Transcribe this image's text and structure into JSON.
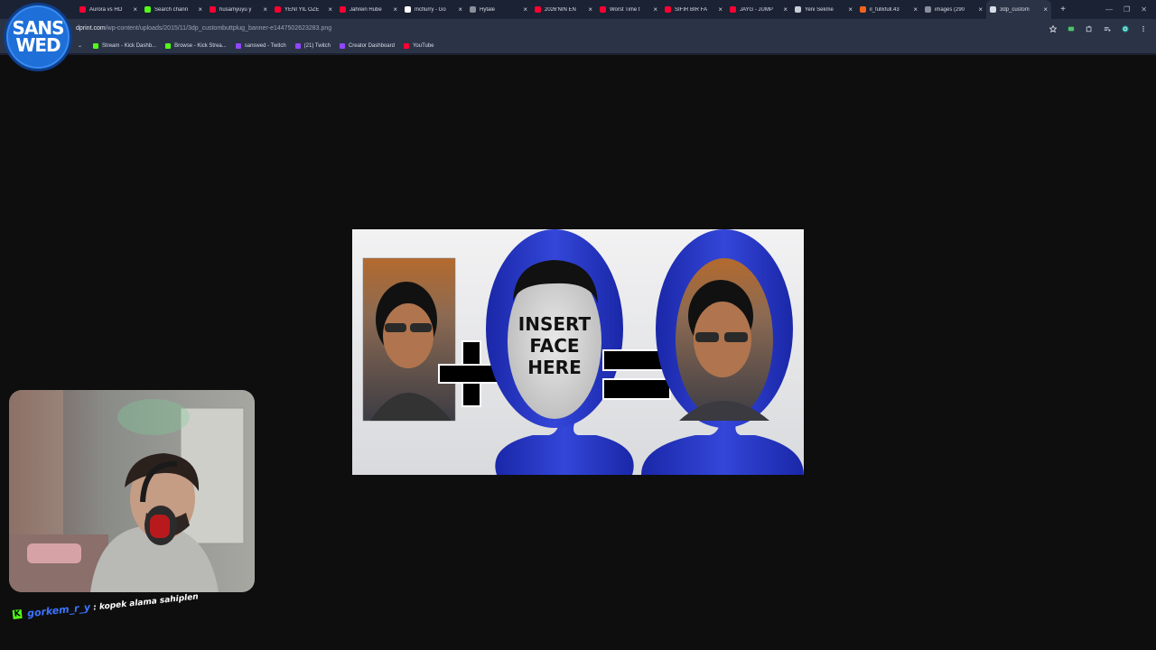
{
  "logo": {
    "line1": "SANS",
    "line2": "WED"
  },
  "tabs": [
    {
      "title": "Aurora vs HO",
      "icon": "youtube-icon",
      "color": "#ff0033"
    },
    {
      "title": "Search chann",
      "icon": "kick-icon",
      "color": "#53fc18"
    },
    {
      "title": "husamyuyu y",
      "icon": "youtube-icon",
      "color": "#ff0033"
    },
    {
      "title": "YENİ YIL ÖZE",
      "icon": "youtube-icon",
      "color": "#ff0033"
    },
    {
      "title": "Jahrein Hube",
      "icon": "youtube-icon",
      "color": "#ff0033"
    },
    {
      "title": "mcflurry - Go",
      "icon": "google-icon",
      "color": "#ffffff"
    },
    {
      "title": "Hytale",
      "icon": "page-icon",
      "color": "#8a8f9c"
    },
    {
      "title": "2026'NIN EN",
      "icon": "youtube-icon",
      "color": "#ff0033"
    },
    {
      "title": "Worst Time t",
      "icon": "youtube-icon",
      "color": "#ff0033"
    },
    {
      "title": "SIFIR BİR FA",
      "icon": "youtube-icon",
      "color": "#ff0033"
    },
    {
      "title": "JAYG - JUMP",
      "icon": "youtube-icon",
      "color": "#ff0033"
    },
    {
      "title": "Yeni Sekme",
      "icon": "chrome-icon",
      "color": "#c9cdd6"
    },
    {
      "title": "il_fullxfull.43",
      "icon": "etsy-icon",
      "color": "#f1641e"
    },
    {
      "title": "images (290",
      "icon": "image-icon",
      "color": "#8a8f9c"
    },
    {
      "title": "3dp_custom",
      "icon": "page-icon",
      "color": "#d8dde8",
      "active": true
    }
  ],
  "tab_close_glyph": "×",
  "new_tab_glyph": "+",
  "window_controls": {
    "minimize": "—",
    "maximize": "❐",
    "close": "✕"
  },
  "address_bar": {
    "host": "dprint.com",
    "path": "/wp-content/uploads/2015/11/3dp_custombuttplug_banner-e1447502623283.png"
  },
  "bookmarks": [
    {
      "label": "Stream - Kick Dashb...",
      "color": "#53fc18"
    },
    {
      "label": "Browse - Kick Strea...",
      "color": "#53fc18"
    },
    {
      "label": "sanswed - Twitch",
      "color": "#9146ff"
    },
    {
      "label": "(21) Twitch",
      "color": "#9146ff"
    },
    {
      "label": "Creator Dashboard",
      "color": "#9146ff"
    },
    {
      "label": "YouTube",
      "color": "#ff0033"
    }
  ],
  "image_text": {
    "line1": "INSERT",
    "line2": "FACE",
    "line3": "HERE"
  },
  "chat": {
    "platform": "K",
    "username": "gorkem_r_y",
    "separator": " : ",
    "message": "kopek alama sahiplen"
  },
  "colors": {
    "accent_blue": "#2233bb",
    "kick_green": "#53fc18",
    "username_blue": "#3b74ff"
  }
}
